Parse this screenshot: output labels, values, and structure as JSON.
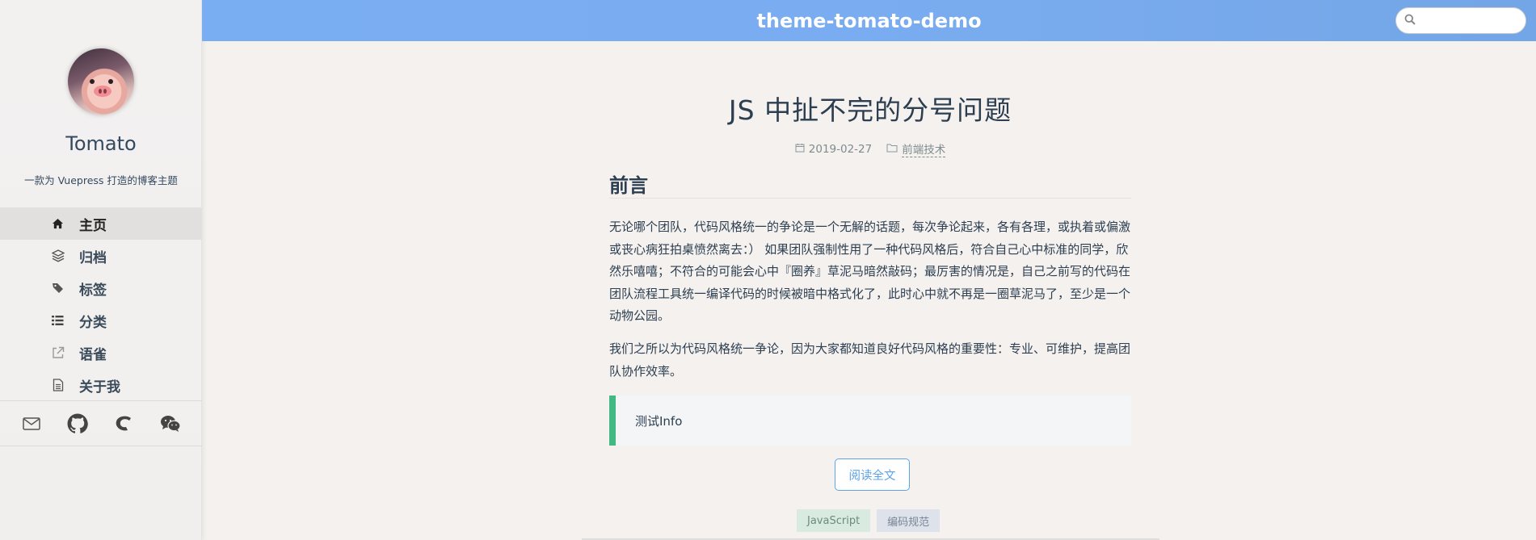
{
  "sidebar": {
    "site_name": "Tomato",
    "site_desc": "一款为 Vuepress 打造的博客主题",
    "nav": [
      {
        "label": "主页",
        "icon": "home-icon",
        "active": true
      },
      {
        "label": "归档",
        "icon": "layers-icon"
      },
      {
        "label": "标签",
        "icon": "tags-icon"
      },
      {
        "label": "分类",
        "icon": "list-icon"
      },
      {
        "label": "语雀",
        "icon": "external-link-icon"
      },
      {
        "label": "关于我",
        "icon": "document-icon"
      }
    ],
    "socials": [
      "mail-icon",
      "github-icon",
      "yuque-icon",
      "wechat-icon"
    ]
  },
  "header": {
    "title": "theme-tomato-demo",
    "search_placeholder": ""
  },
  "post": {
    "title": "JS 中扯不完的分号问题",
    "date": "2019-02-27",
    "category": "前端技术",
    "heading": "前言",
    "paragraphs": [
      "无论哪个团队，代码风格统一的争论是一个无解的话题，每次争论起来，各有各理，或执着或偏激或丧心病狂拍桌愤然离去：） 如果团队强制性用了一种代码风格后，符合自己心中标准的同学，欣然乐嘻嘻；不符合的可能会心中『圈养』草泥马暗然敲码；最厉害的情况是，自己之前写的代码在团队流程工具统一编译代码的时候被暗中格式化了，此时心中就不再是一圈草泥马了，至少是一个动物公园。",
      "我们之所以为代码风格统一争论，因为大家都知道良好代码风格的重要性：专业、可维护，提高团队协作效率。"
    ],
    "tip": "测试Info",
    "read_more": "阅读全文",
    "tags": [
      "JavaScript",
      "编码规范"
    ]
  },
  "colors": {
    "header_start": "#7aaef3",
    "accent_green": "#42b983",
    "accent_blue": "#5da3e8"
  }
}
